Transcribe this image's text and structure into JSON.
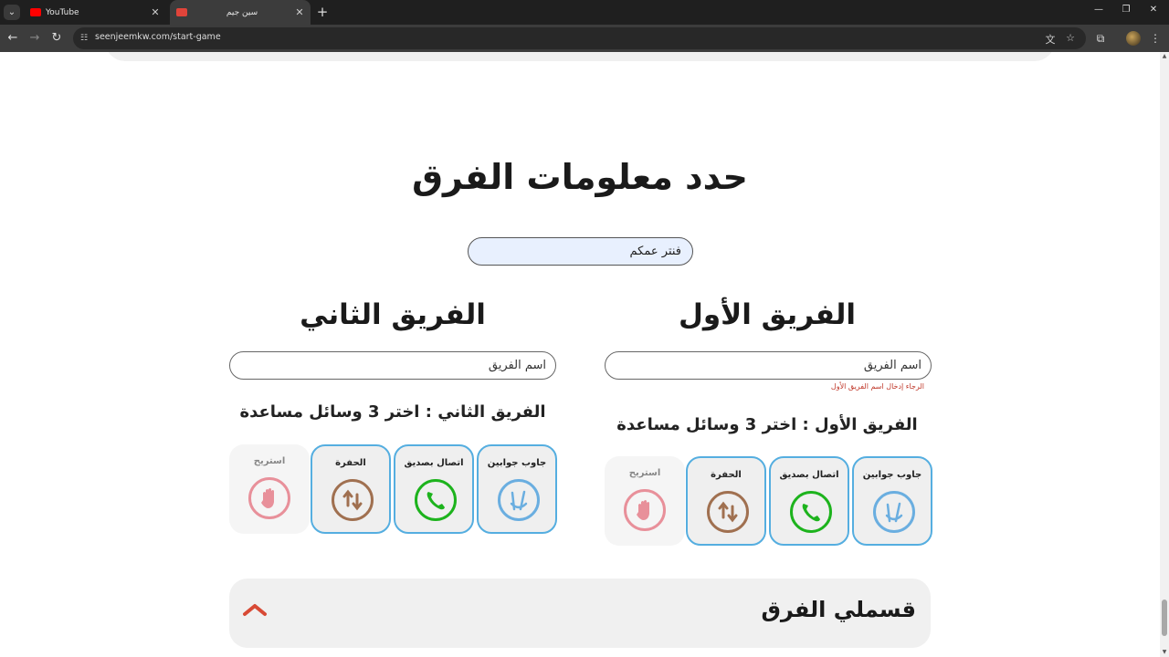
{
  "browser": {
    "tabs": [
      {
        "title": "YouTube",
        "favicon_color": "#ff0000",
        "active": false
      },
      {
        "title": "سين جيم",
        "favicon_color": "#e0443a",
        "active": true
      }
    ],
    "url": "seenjeemkw.com/start-game"
  },
  "page": {
    "heading": "حدد معلومات الفرق",
    "game_name_value": "فنتر عمكم",
    "team1": {
      "title": "الفريق الأول",
      "input_placeholder": "اسم الفريق",
      "error": "الرجاء إدخال اسم الفريق الأول",
      "subtitle": "الفريق الأول : اختر 3 وسائل مساعدة",
      "aids": [
        {
          "label": "جاوب جوابين",
          "icon": "peace-hand-icon",
          "color": "#6aaee0",
          "selected": true
        },
        {
          "label": "اتصال بصديق",
          "icon": "phone-icon",
          "color": "#1db31d",
          "selected": true
        },
        {
          "label": "الحفرة",
          "icon": "swap-arrows-icon",
          "color": "#a07050",
          "selected": true
        },
        {
          "label": "استريح",
          "icon": "stop-hand-icon",
          "color": "#e8909a",
          "selected": false
        }
      ]
    },
    "team2": {
      "title": "الفريق الثاني",
      "input_placeholder": "اسم الفريق",
      "subtitle": "الفريق الثاني : اختر 3 وسائل مساعدة",
      "aids": [
        {
          "label": "جاوب جوابين",
          "icon": "peace-hand-icon",
          "color": "#6aaee0",
          "selected": true
        },
        {
          "label": "اتصال بصديق",
          "icon": "phone-icon",
          "color": "#1db31d",
          "selected": true
        },
        {
          "label": "الحفرة",
          "icon": "swap-arrows-icon",
          "color": "#a07050",
          "selected": true
        },
        {
          "label": "استريح",
          "icon": "stop-hand-icon",
          "color": "#e8909a",
          "selected": false
        }
      ]
    },
    "split_teams": {
      "title": "قسملي الفرق",
      "chevron_color": "#d84a35"
    }
  }
}
